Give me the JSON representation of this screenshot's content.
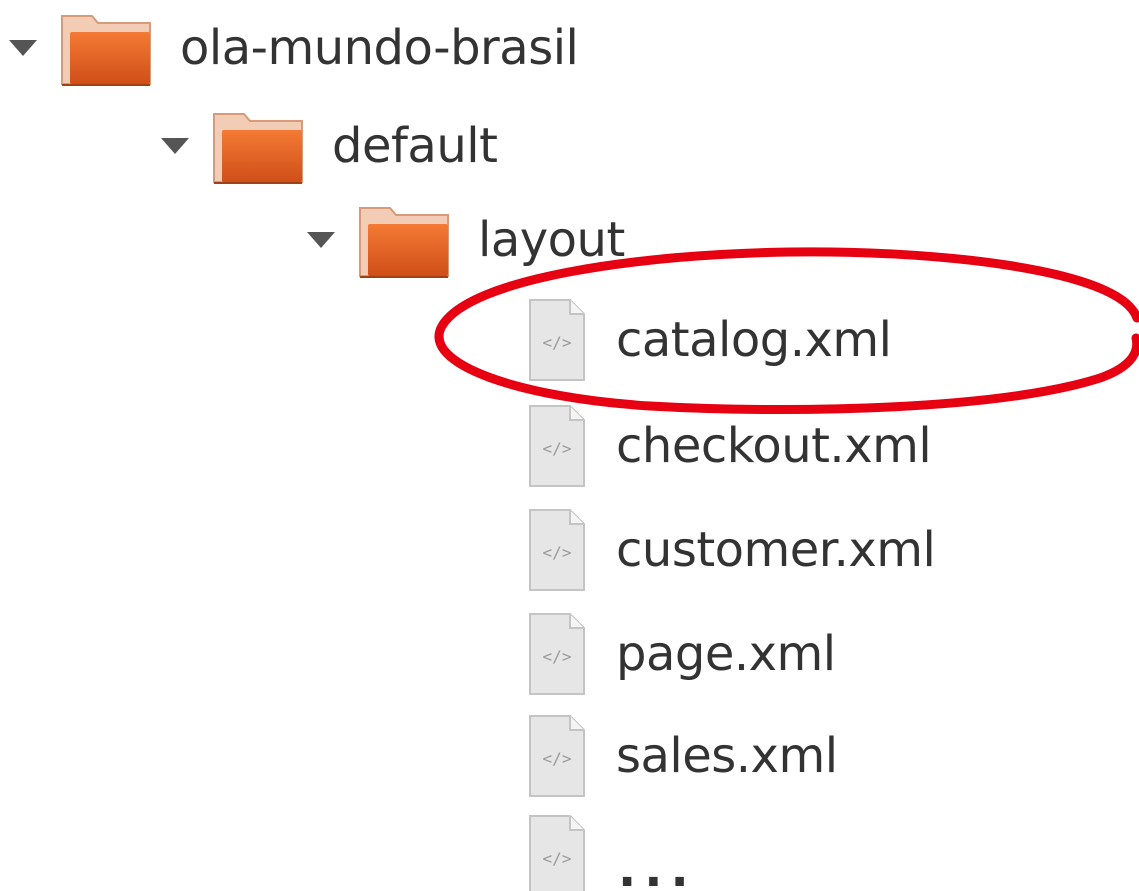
{
  "tree": {
    "root": {
      "label": "ola-mundo-brasil",
      "icon": "folder-icon",
      "expanded": true
    },
    "default_folder": {
      "label": "default",
      "icon": "folder-icon",
      "expanded": true
    },
    "layout_folder": {
      "label": "layout",
      "icon": "folder-icon",
      "expanded": true
    },
    "files": [
      {
        "label": "catalog.xml",
        "icon": "xml-file-icon"
      },
      {
        "label": "checkout.xml",
        "icon": "xml-file-icon"
      },
      {
        "label": "customer.xml",
        "icon": "xml-file-icon"
      },
      {
        "label": "page.xml",
        "icon": "xml-file-icon"
      },
      {
        "label": "sales.xml",
        "icon": "xml-file-icon"
      },
      {
        "label": "...",
        "icon": "xml-file-icon"
      }
    ]
  },
  "highlight": {
    "target": "catalog.xml",
    "color": "#e60012"
  },
  "colors": {
    "folder_main": "#e8672a",
    "folder_tab": "#f7d7c4",
    "text": "#333333",
    "toggle": "#555555",
    "file_body": "#e6e6e6"
  }
}
